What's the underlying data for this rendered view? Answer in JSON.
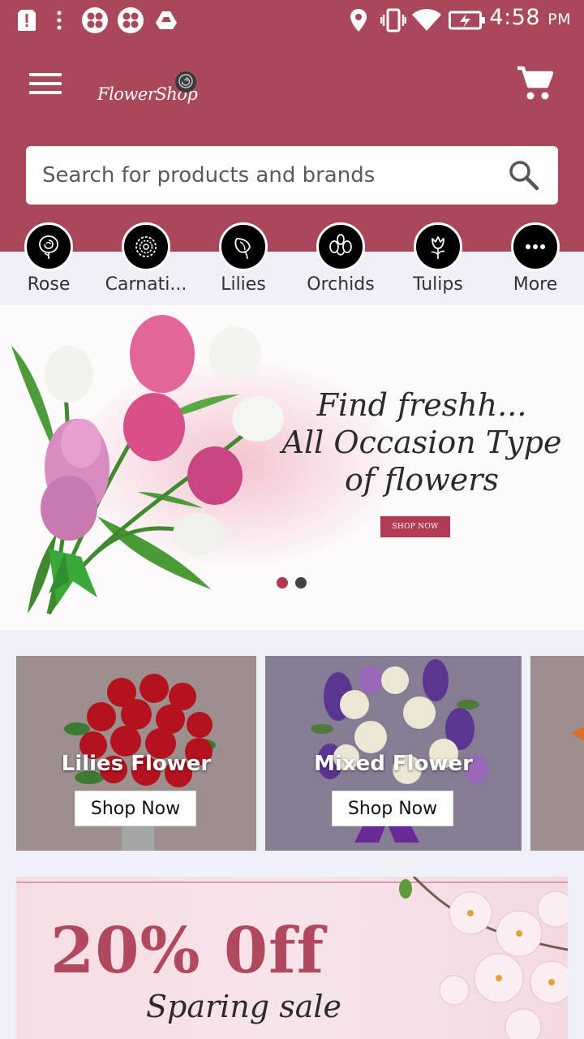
{
  "status_bar": {
    "time": "4:58",
    "ampm": "PM",
    "icons": [
      "alert-icon",
      "more-dots-icon",
      "clover-icon",
      "clover-icon",
      "drive-icon",
      "location-icon",
      "vibrate-icon",
      "wifi-icon",
      "battery-charging-icon"
    ]
  },
  "header": {
    "logo_text": "FlowerShop",
    "menu_icon": "hamburger-menu-icon",
    "cart_icon": "cart-icon",
    "bg_color": "#a9485b"
  },
  "search": {
    "placeholder": "Search for products and brands",
    "icon": "search-icon"
  },
  "categories": [
    {
      "label": "Rose",
      "icon": "rose-icon"
    },
    {
      "label": "Carnati...",
      "icon": "carnation-icon"
    },
    {
      "label": "Lilies",
      "icon": "lily-icon"
    },
    {
      "label": "Orchids",
      "icon": "orchid-icon"
    },
    {
      "label": "Tulips",
      "icon": "tulip-icon"
    },
    {
      "label": "More",
      "icon": "more-icon"
    }
  ],
  "hero": {
    "line1": "Find freshh...",
    "line2": "All Occasion Type",
    "line3": "of flowers",
    "button": "SHOP NOW",
    "active_dot_color": "#b03b53",
    "inactive_dot_color": "#444444"
  },
  "products": [
    {
      "title": "Lilies Flower",
      "button": "Shop Now",
      "bg": "#9c8f8d"
    },
    {
      "title": "Mixed Flower",
      "button": "Shop Now",
      "bg": "#857d93"
    }
  ],
  "sale": {
    "title": "20% 0ff",
    "subtitle": "Sparing sale"
  }
}
